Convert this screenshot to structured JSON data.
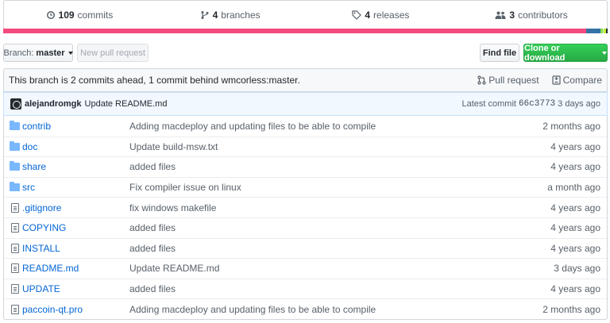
{
  "summary": {
    "commits": {
      "count": "109",
      "label": "commits"
    },
    "branches": {
      "count": "4",
      "label": "branches"
    },
    "releases": {
      "count": "4",
      "label": "releases"
    },
    "contributors": {
      "count": "3",
      "label": "contributors"
    }
  },
  "language_bar": [
    {
      "color": "#f34b7d",
      "share": 96.4
    },
    {
      "color": "#3572a5",
      "share": 2.4
    },
    {
      "color": "#89e051",
      "share": 0.4
    },
    {
      "color": "#e6e6e6",
      "share": 0.2
    },
    {
      "color": "#c1f12e",
      "share": 0.3
    },
    {
      "color": "#24292e",
      "share": 0.3
    }
  ],
  "toolbar": {
    "branch_label": "Branch:",
    "branch_value": "master",
    "new_pr": "New pull request",
    "find_file": "Find file",
    "clone": "Clone or download"
  },
  "ahead_bar": {
    "message": "This branch is 2 commits ahead, 1 commit behind wmcorless:master.",
    "pull_request": "Pull request",
    "compare": "Compare"
  },
  "latest_commit": {
    "author": "alejandromgk",
    "message": "Update README.md",
    "prefix": "Latest commit",
    "sha": "66c3773",
    "age": "3 days ago"
  },
  "files": [
    {
      "type": "dir",
      "name": "contrib",
      "message": "Adding macdeploy and updating files to be able to compile",
      "age": "2 months ago"
    },
    {
      "type": "dir",
      "name": "doc",
      "message": "Update build-msw.txt",
      "age": "4 years ago"
    },
    {
      "type": "dir",
      "name": "share",
      "message": "added files",
      "age": "4 years ago"
    },
    {
      "type": "dir",
      "name": "src",
      "message": "Fix compiler issue on linux",
      "age": "a month ago"
    },
    {
      "type": "file",
      "name": ".gitignore",
      "message": "fix windows makefile",
      "age": "4 years ago"
    },
    {
      "type": "file",
      "name": "COPYING",
      "message": "added files",
      "age": "4 years ago"
    },
    {
      "type": "file",
      "name": "INSTALL",
      "message": "added files",
      "age": "4 years ago"
    },
    {
      "type": "file",
      "name": "README.md",
      "message": "Update README.md",
      "age": "3 days ago"
    },
    {
      "type": "file",
      "name": "UPDATE",
      "message": "added files",
      "age": "4 years ago"
    },
    {
      "type": "file",
      "name": "paccoin-qt.pro",
      "message": "Adding macdeploy and updating files to be able to compile",
      "age": "2 months ago"
    }
  ]
}
